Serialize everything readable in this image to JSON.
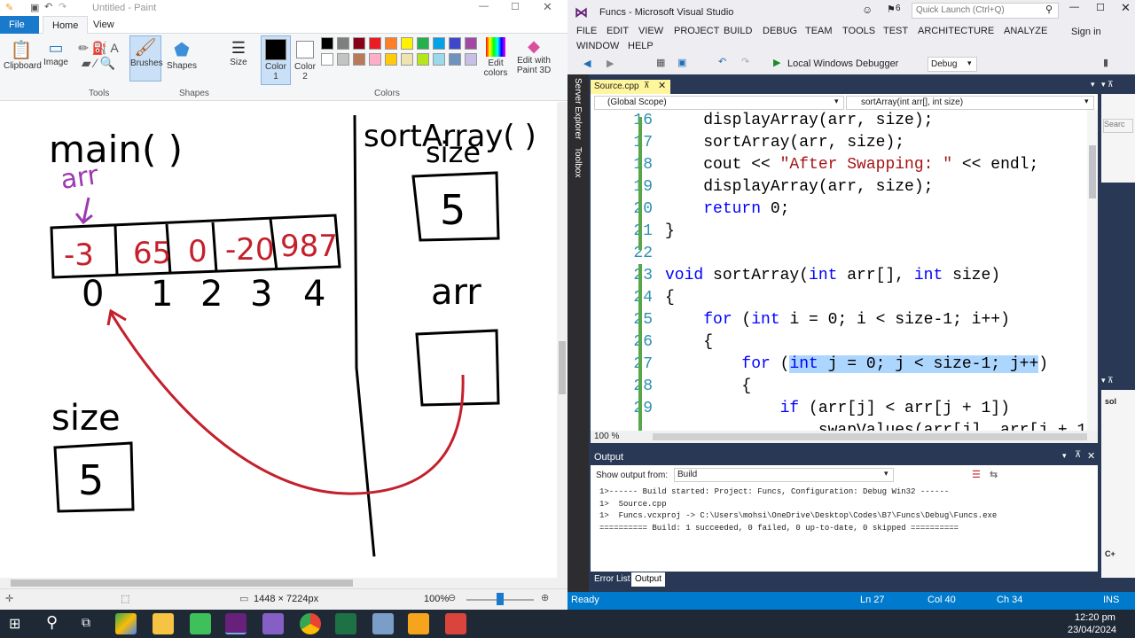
{
  "paint": {
    "title": "Untitled - Paint",
    "tabs": [
      "File",
      "Home",
      "View"
    ],
    "tools": {
      "clipboard": "Clipboard",
      "image": "Image",
      "brushes": "Brushes",
      "shapes": "Shapes",
      "size": "Size",
      "color1": "Color 1",
      "color2": "Color 2",
      "edit_colors": "Edit colors",
      "edit_3d": "Edit with Paint 3D"
    },
    "groups": {
      "tools": "Tools",
      "shapes": "Shapes",
      "colors": "Colors"
    },
    "palette": [
      "#000000",
      "#7f7f7f",
      "#880015",
      "#ed1c24",
      "#ff7f27",
      "#fff200",
      "#22b14c",
      "#00a2e8",
      "#3f48cc",
      "#a349a4",
      "#ffffff",
      "#c3c3c3",
      "#b97a57",
      "#ffaec9",
      "#ffc90e",
      "#efe4b0",
      "#b5e61d",
      "#99d9ea",
      "#7092be",
      "#c8bfe7"
    ],
    "status": {
      "size": "1448 × 7224px",
      "zoom": "100%"
    },
    "drawing": {
      "main_label": "main( )",
      "arr_label": "arr",
      "array_values": [
        "-3",
        "65",
        "0",
        "-20",
        "987"
      ],
      "indices": [
        "0",
        "1",
        "2",
        "3",
        "4"
      ],
      "size_label": "size",
      "size_value": "5",
      "sort_label": "sortArray( )",
      "sort_size_label": "size",
      "sort_size_value": "5",
      "sort_arr_label": "arr"
    }
  },
  "vs": {
    "title": "Funcs - Microsoft Visual Studio",
    "notif_count": "6",
    "quick_launch": "Quick Launch (Ctrl+Q)",
    "menu": [
      "FILE",
      "EDIT",
      "VIEW",
      "PROJECT",
      "BUILD",
      "DEBUG",
      "TEAM",
      "TOOLS",
      "TEST",
      "ARCHITECTURE",
      "ANALYZE",
      "WINDOW",
      "HELP"
    ],
    "sign_in": "Sign in",
    "debugger": "Local Windows Debugger",
    "config": "Debug",
    "side_tabs": [
      "Server Explorer",
      "Toolbox"
    ],
    "doc_tab": "Source.cpp",
    "scope": "(Global Scope)",
    "member": "sortArray(int arr[], int size)",
    "zoom": "100 %",
    "code_lines": [
      {
        "n": "16",
        "t": "    displayArray(arr, size);"
      },
      {
        "n": "17",
        "t": "    sortArray(arr, size);"
      },
      {
        "n": "18",
        "t": "    cout << \"After Swapping: \" << endl;"
      },
      {
        "n": "19",
        "t": "    displayArray(arr, size);"
      },
      {
        "n": "20",
        "t": "    return 0;"
      },
      {
        "n": "21",
        "t": "}"
      },
      {
        "n": "22",
        "t": ""
      },
      {
        "n": "23",
        "t": "void sortArray(int arr[], int size)"
      },
      {
        "n": "24",
        "t": "{"
      },
      {
        "n": "25",
        "t": "    for (int i = 0; i < size-1; i++)"
      },
      {
        "n": "26",
        "t": "    {"
      },
      {
        "n": "27",
        "t": "        for (int j = 0; j < size-1; j++)"
      },
      {
        "n": "28",
        "t": "        {"
      },
      {
        "n": "29",
        "t": "            if (arr[j] < arr[j + 1])"
      }
    ],
    "partial_line": "                swapValues(arr[j], arr[j + 1",
    "output": {
      "title": "Output",
      "show_from_label": "Show output from:",
      "source": "Build",
      "lines": [
        "1>------ Build started: Project: Funcs, Configuration: Debug Win32 ------",
        "1>  Source.cpp",
        "1>  Funcs.vcxproj -> C:\\Users\\mohsi\\OneDrive\\Desktop\\Codes\\B7\\Funcs\\Debug\\Funcs.exe",
        "========== Build: 1 succeeded, 0 failed, 0 up-to-date, 0 skipped =========="
      ],
      "tabs": [
        "Error List",
        "Output"
      ]
    },
    "right_search": "Searc",
    "right_label": "sol",
    "status": {
      "state": "Ready",
      "ln": "Ln 27",
      "col": "Col 40",
      "ch": "Ch 34",
      "ins": "INS"
    }
  },
  "taskbar": {
    "time": "12:20 pm",
    "date": "23/04/2024"
  }
}
